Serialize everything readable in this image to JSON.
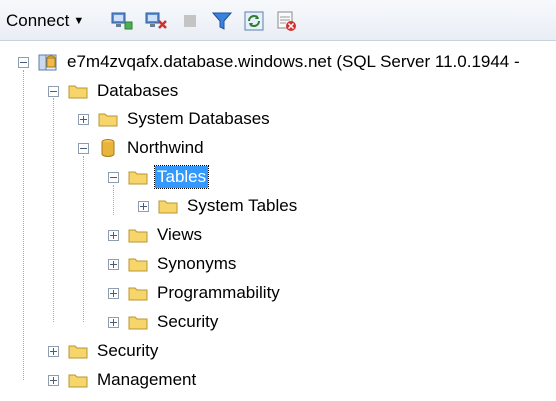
{
  "toolbar": {
    "connect_label": "Connect",
    "icons": [
      "connect-object-explorer-icon",
      "disconnect-icon",
      "stop-icon",
      "filter-icon",
      "refresh-icon",
      "activity-monitor-icon"
    ]
  },
  "tree": {
    "server": "e7m4zvqafx.database.windows.net (SQL Server 11.0.1944 -",
    "databases": "Databases",
    "system_databases": "System Databases",
    "northwind": "Northwind",
    "tables": "Tables",
    "system_tables": "System Tables",
    "views": "Views",
    "synonyms": "Synonyms",
    "programmability": "Programmability",
    "db_security": "Security",
    "security": "Security",
    "management": "Management"
  },
  "colors": {
    "folder": "#f6d66a",
    "selection": "#3399ff",
    "database": "#e8b43c"
  }
}
